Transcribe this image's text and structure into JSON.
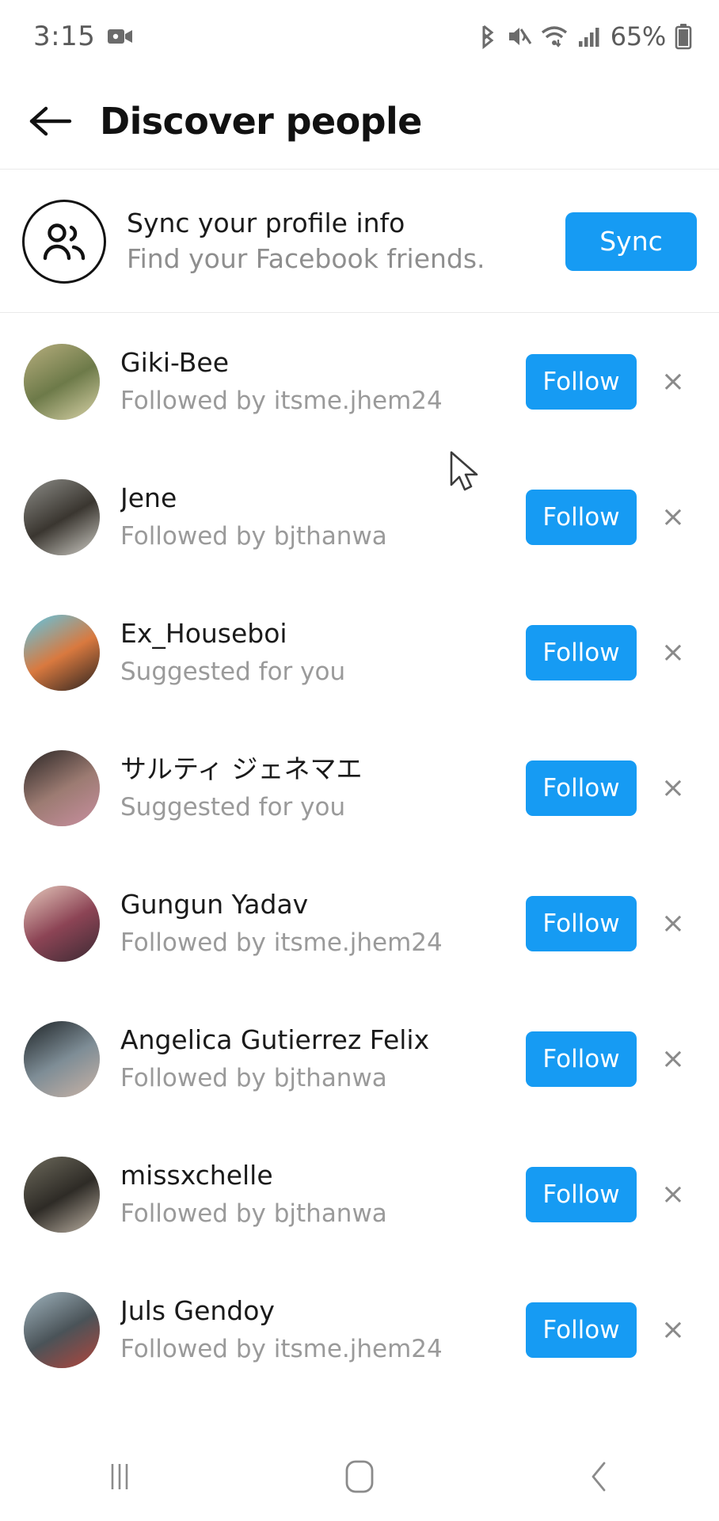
{
  "status_bar": {
    "time": "3:15",
    "battery_percent": "65%",
    "icons": [
      "video-recording-icon",
      "bluetooth-icon",
      "mute-icon",
      "wifi-icon",
      "cellular-signal-icon",
      "battery-icon"
    ]
  },
  "app_bar": {
    "back_icon": "back-arrow-icon",
    "title": "Discover people"
  },
  "sync_banner": {
    "icon": "people-icon",
    "title": "Sync your profile info",
    "subtitle": "Find your Facebook friends.",
    "button_label": "Sync"
  },
  "colors": {
    "accent_blue": "#169bf3",
    "primary_text": "#1a1a1a",
    "secondary_text": "#9a9a9a",
    "divider": "#eaeaea"
  },
  "suggestions": {
    "follow_label": "Follow",
    "dismiss_label": "×",
    "items": [
      {
        "name": "Giki-Bee",
        "subtitle": "Followed by itsme.jhem24",
        "avatar_colors": [
          "#b7ae7e",
          "#6d7a49",
          "#d9d3a8"
        ]
      },
      {
        "name": "Jene",
        "subtitle": "Followed by bjthanwa",
        "avatar_colors": [
          "#8d8d88",
          "#3a3630",
          "#cfcdc6"
        ]
      },
      {
        "name": "Ex_Houseboi",
        "subtitle": "Suggested for you",
        "avatar_colors": [
          "#5bc8e8",
          "#d9793f",
          "#2b2320"
        ]
      },
      {
        "name": "サルティ ジェネマエ",
        "subtitle": "Suggested for you",
        "avatar_colors": [
          "#2a2524",
          "#9c7b72",
          "#c98fa0"
        ]
      },
      {
        "name": "Gungun Yadav",
        "subtitle": "Followed by itsme.jhem24",
        "avatar_colors": [
          "#e6c9bc",
          "#8c4455",
          "#3b2a33"
        ]
      },
      {
        "name": "Angelica Gutierrez Felix",
        "subtitle": "Followed by bjthanwa",
        "avatar_colors": [
          "#1d2326",
          "#7e8d96",
          "#c9b3a6"
        ]
      },
      {
        "name": "missxchelle",
        "subtitle": "Followed by bjthanwa",
        "avatar_colors": [
          "#6d6a5c",
          "#2e2b26",
          "#bdb2a4"
        ]
      },
      {
        "name": "Juls Gendoy",
        "subtitle": "Followed by itsme.jhem24",
        "avatar_colors": [
          "#9fb3bd",
          "#4a5358",
          "#b2453c"
        ]
      }
    ]
  },
  "nav_bar": {
    "recents_label": "recents-icon",
    "home_label": "home-icon",
    "back_label": "back-icon"
  }
}
